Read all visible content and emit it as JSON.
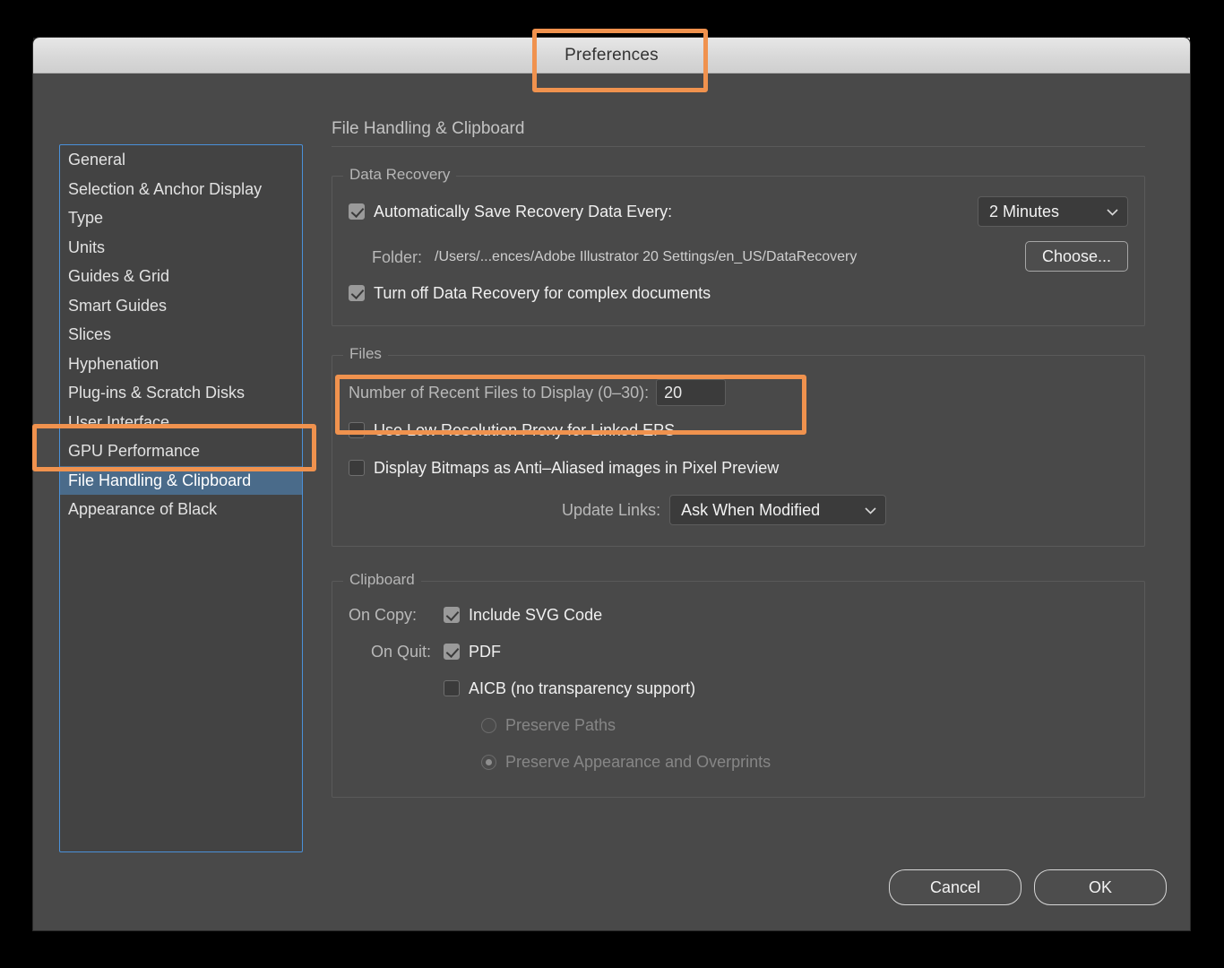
{
  "window": {
    "title": "Preferences"
  },
  "sidebar": {
    "items": [
      {
        "label": "General",
        "selected": false
      },
      {
        "label": "Selection & Anchor Display",
        "selected": false
      },
      {
        "label": "Type",
        "selected": false
      },
      {
        "label": "Units",
        "selected": false
      },
      {
        "label": "Guides & Grid",
        "selected": false
      },
      {
        "label": "Smart Guides",
        "selected": false
      },
      {
        "label": "Slices",
        "selected": false
      },
      {
        "label": "Hyphenation",
        "selected": false
      },
      {
        "label": "Plug-ins & Scratch Disks",
        "selected": false
      },
      {
        "label": "User Interface",
        "selected": false
      },
      {
        "label": "GPU Performance",
        "selected": false
      },
      {
        "label": "File Handling & Clipboard",
        "selected": true
      },
      {
        "label": "Appearance of Black",
        "selected": false
      }
    ]
  },
  "panel": {
    "title": "File Handling & Clipboard",
    "data_recovery": {
      "legend": "Data Recovery",
      "auto_save_label": "Automatically Save Recovery Data Every:",
      "auto_save_checked": "checked",
      "interval_value": "2 Minutes",
      "folder_label": "Folder:",
      "folder_path": "/Users/...ences/Adobe Illustrator 20 Settings/en_US/DataRecovery",
      "choose_button": "Choose...",
      "turn_off_label": "Turn off Data Recovery for complex documents"
    },
    "files": {
      "legend": "Files",
      "recent_files_label": "Number of Recent Files to Display (0–30):",
      "recent_files_value": "20",
      "low_res_proxy_label": "Use Low Resolution Proxy for Linked EPS",
      "anti_aliased_label": "Display Bitmaps as Anti–Aliased images in Pixel Preview",
      "update_links_label": "Update Links:",
      "update_links_value": "Ask When Modified"
    },
    "clipboard": {
      "legend": "Clipboard",
      "on_copy_label": "On Copy:",
      "include_svg_label": "Include SVG Code",
      "on_quit_label": "On Quit:",
      "pdf_label": "PDF",
      "aicb_label": "AICB (no transparency support)",
      "preserve_paths_label": "Preserve Paths",
      "preserve_appearance_label": "Preserve Appearance and Overprints"
    }
  },
  "footer": {
    "cancel_label": "Cancel",
    "ok_label": "OK"
  },
  "icons": {
    "chevron_down": "⌄"
  },
  "colors": {
    "highlight": "#f0924e",
    "selection": "#4a6b8a",
    "list_border": "#4a90d9",
    "dialog_bg": "#494949"
  }
}
